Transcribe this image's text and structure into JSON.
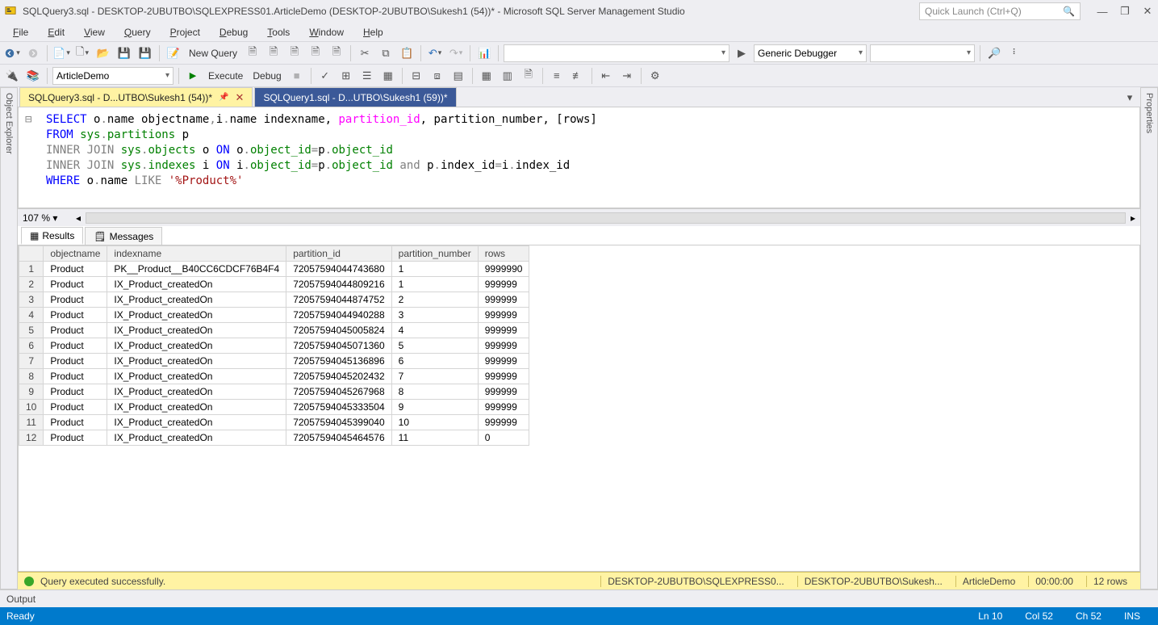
{
  "title_bar": {
    "text": "SQLQuery3.sql - DESKTOP-2UBUTBO\\SQLEXPRESS01.ArticleDemo (DESKTOP-2UBUTBO\\Sukesh1 (54))* - Microsoft SQL Server Management Studio"
  },
  "quick_launch": {
    "placeholder": "Quick Launch (Ctrl+Q)"
  },
  "menu": {
    "file": "File",
    "edit": "Edit",
    "view": "View",
    "query": "Query",
    "project": "Project",
    "debug": "Debug",
    "tools": "Tools",
    "window": "Window",
    "help": "Help"
  },
  "toolbar1": {
    "new_query": "New Query",
    "generic_debugger": "Generic Debugger"
  },
  "toolbar2": {
    "database": "ArticleDemo",
    "execute": "Execute",
    "debug": "Debug"
  },
  "left_pane": {
    "label": "Object Explorer"
  },
  "right_pane": {
    "label": "Properties"
  },
  "tabs": {
    "active": "SQLQuery3.sql - D...UTBO\\Sukesh1 (54))*",
    "inactive": "SQLQuery1.sql - D...UTBO\\Sukesh1 (59))*"
  },
  "sql": {
    "l1a": "SELECT",
    "l1b": " o",
    "l1c": ".",
    "l1d": "name",
    "l1e": " objectname",
    "l1f": ",",
    "l1g": "i",
    "l1h": ".",
    "l1i": "name",
    "l1j": " indexname",
    "l1k": ", ",
    "l1l": "partition_id",
    "l1m": ", partition_number, [rows]",
    "l2a": "FROM",
    "l2b": " sys",
    "l2c": ".",
    "l2d": "partitions",
    "l2e": " p",
    "l3a": "INNER",
    "l3b": " JOIN",
    "l3c": " sys",
    "l3d": ".",
    "l3e": "objects",
    "l3f": " o ",
    "l3g": "ON",
    "l3h": " o",
    "l3i": ".",
    "l3j": "object_id",
    "l3k": "=",
    "l3l": "p",
    "l3m": ".",
    "l3n": "object_id",
    "l4a": "INNER",
    "l4b": " JOIN",
    "l4c": " sys",
    "l4d": ".",
    "l4e": "indexes",
    "l4f": " i ",
    "l4g": "ON",
    "l4h": " i",
    "l4i": ".",
    "l4j": "object_id",
    "l4k": "=",
    "l4l": "p",
    "l4m": ".",
    "l4n": "object_id",
    "l4o": " and",
    "l4p": " p",
    "l4q": ".",
    "l4r": "index_id",
    "l4s": "=",
    "l4t": "i",
    "l4u": ".",
    "l4v": "index_id",
    "l5a": "WHERE",
    "l5b": " o",
    "l5c": ".",
    "l5d": "name",
    "l5e": " LIKE",
    "l5f": " '%Product%'"
  },
  "zoom": {
    "value": "107 %"
  },
  "result_tabs": {
    "results": "Results",
    "messages": "Messages"
  },
  "grid": {
    "cols": [
      "objectname",
      "indexname",
      "partition_id",
      "partition_number",
      "rows"
    ],
    "rows": [
      [
        "Product",
        "PK__Product__B40CC6CDCF76B4F4",
        "72057594044743680",
        "1",
        "9999990"
      ],
      [
        "Product",
        "IX_Product_createdOn",
        "72057594044809216",
        "1",
        "999999"
      ],
      [
        "Product",
        "IX_Product_createdOn",
        "72057594044874752",
        "2",
        "999999"
      ],
      [
        "Product",
        "IX_Product_createdOn",
        "72057594044940288",
        "3",
        "999999"
      ],
      [
        "Product",
        "IX_Product_createdOn",
        "72057594045005824",
        "4",
        "999999"
      ],
      [
        "Product",
        "IX_Product_createdOn",
        "72057594045071360",
        "5",
        "999999"
      ],
      [
        "Product",
        "IX_Product_createdOn",
        "72057594045136896",
        "6",
        "999999"
      ],
      [
        "Product",
        "IX_Product_createdOn",
        "72057594045202432",
        "7",
        "999999"
      ],
      [
        "Product",
        "IX_Product_createdOn",
        "72057594045267968",
        "8",
        "999999"
      ],
      [
        "Product",
        "IX_Product_createdOn",
        "72057594045333504",
        "9",
        "999999"
      ],
      [
        "Product",
        "IX_Product_createdOn",
        "72057594045399040",
        "10",
        "999999"
      ],
      [
        "Product",
        "IX_Product_createdOn",
        "72057594045464576",
        "11",
        "0"
      ]
    ]
  },
  "exec_status": {
    "msg": "Query executed successfully.",
    "server": "DESKTOP-2UBUTBO\\SQLEXPRESS0...",
    "user": "DESKTOP-2UBUTBO\\Sukesh...",
    "db": "ArticleDemo",
    "time": "00:00:00",
    "rows": "12 rows"
  },
  "output_panel": {
    "label": "Output"
  },
  "status_bar": {
    "ready": "Ready",
    "ln": "Ln 10",
    "col": "Col 52",
    "ch": "Ch 52",
    "ins": "INS"
  }
}
